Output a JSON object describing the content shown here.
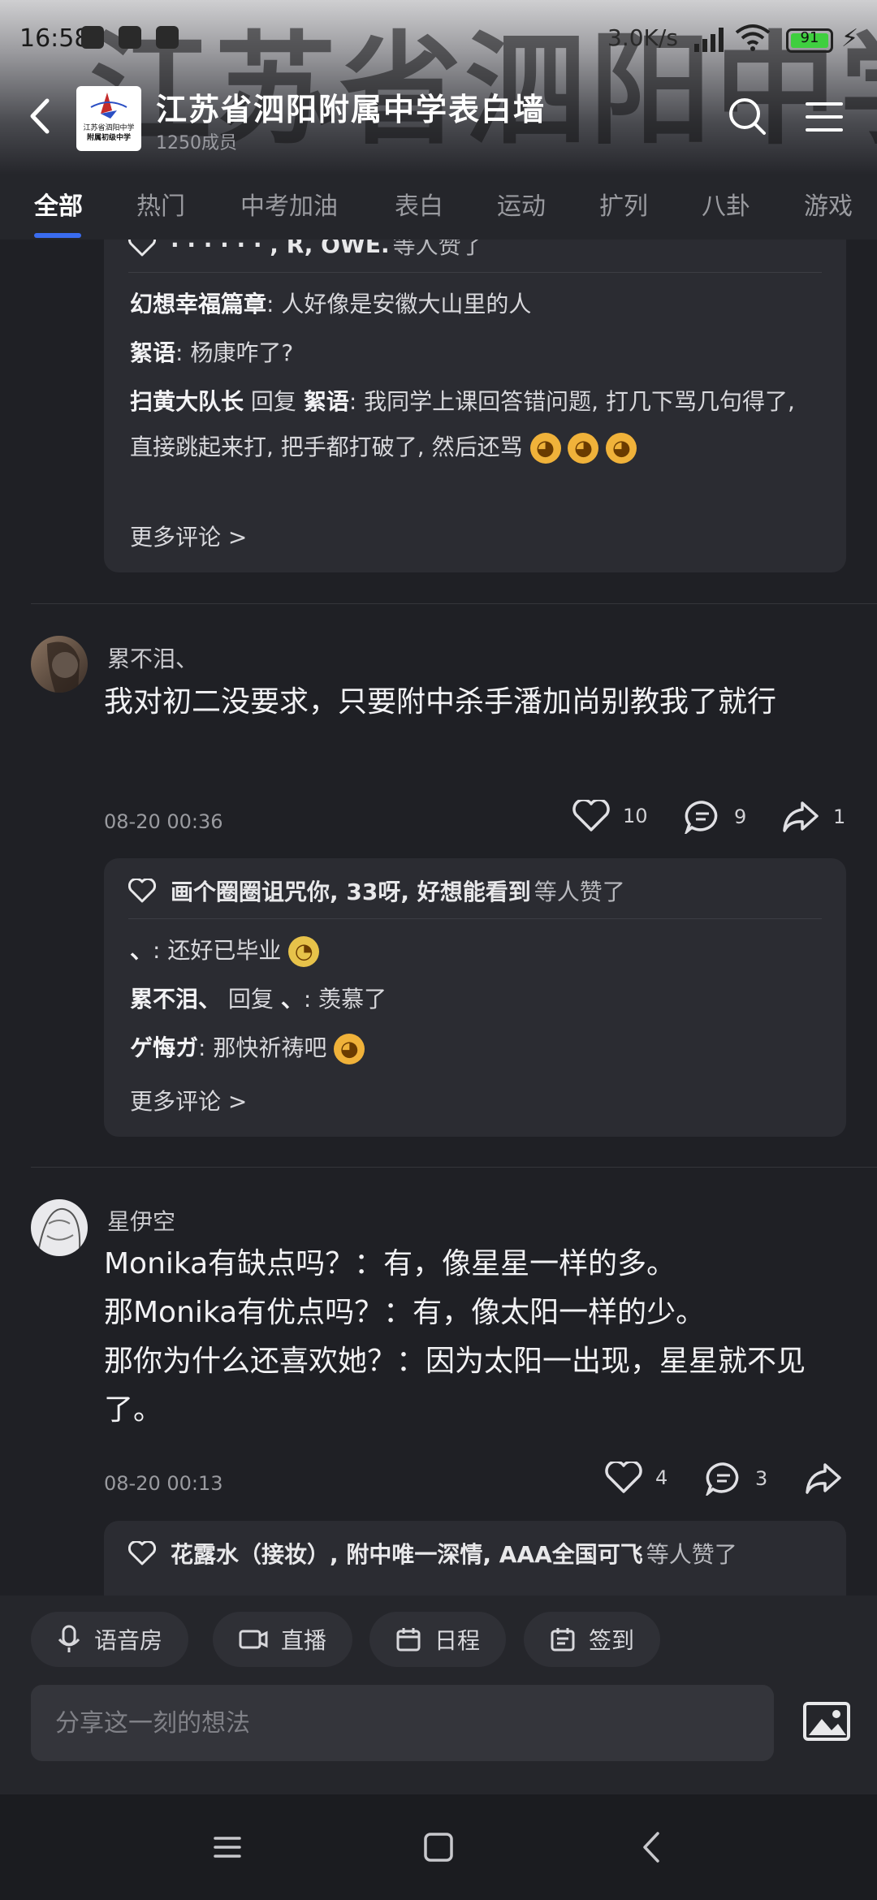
{
  "status_bar": {
    "time": "16:58",
    "speed": "3.0K/s",
    "battery": "91"
  },
  "header": {
    "calligraphy": "江苏省泗阳中学",
    "title": "江苏省泗阳附属中学表白墙",
    "subtitle": "1250成员",
    "logo_text": "江苏省泗阳中学",
    "logo_caption": "附属初级中学"
  },
  "tabs": [
    "全部",
    "热门",
    "中考加油",
    "表白",
    "运动",
    "扩列",
    "八卦",
    "游戏"
  ],
  "posts": [
    {
      "card": {
        "likes_names": "· · · · · · , R, OWE.",
        "likes_suffix": "等人赞了",
        "comments": [
          {
            "name": "幻想幸福篇章",
            "text": ": 人好像是安徽大山里的人"
          },
          {
            "name": "絮语",
            "text": ": 杨康咋了?"
          },
          {
            "name": "扫黄大队长",
            "reply": " 回复 ",
            "reply_to": "絮语",
            "text": ": 我同学上课回答错问题, 打几下骂几句得了, 直接跳起来打, 把手都打破了, 然后还骂"
          }
        ],
        "more": "更多评论 >"
      }
    },
    {
      "author": "累不泪、",
      "text": "我对初二没要求，只要附中杀手潘加尚别教我了就行",
      "time": "08-20 00:36",
      "likes": "10",
      "comments": "9",
      "shares": "1",
      "card": {
        "likes_names": "画个圈圈诅咒你, 33呀, 好想能看到",
        "likes_suffix": "等人赞了",
        "comments": [
          {
            "name": "、",
            "text": ": 还好已毕业"
          },
          {
            "name": "累不泪、",
            "reply": " 回复 ",
            "reply_to": "、",
            "text": ": 羡慕了"
          },
          {
            "name": "ゲ悔ガ",
            "text": ": 那快祈祷吧"
          }
        ],
        "more": "更多评论 >"
      }
    },
    {
      "author": "星伊空",
      "text_lines": [
        "Monika有缺点吗？：有，像星星一样的多。",
        "那Monika有优点吗？：有，像太阳一样的少。",
        "那你为什么还喜欢她？：因为太阳一出现，星星就不见了。"
      ],
      "time": "08-20 00:13",
      "likes": "4",
      "comments": "3",
      "card": {
        "likes_names": "花露水（接妆）, 附中唯一深情, AAA全国可飞",
        "likes_suffix": "等人赞了"
      }
    }
  ],
  "bottom": {
    "chips": [
      "语音房",
      "直播",
      "日程",
      "签到"
    ],
    "input_placeholder": "分享这一刻的想法"
  }
}
